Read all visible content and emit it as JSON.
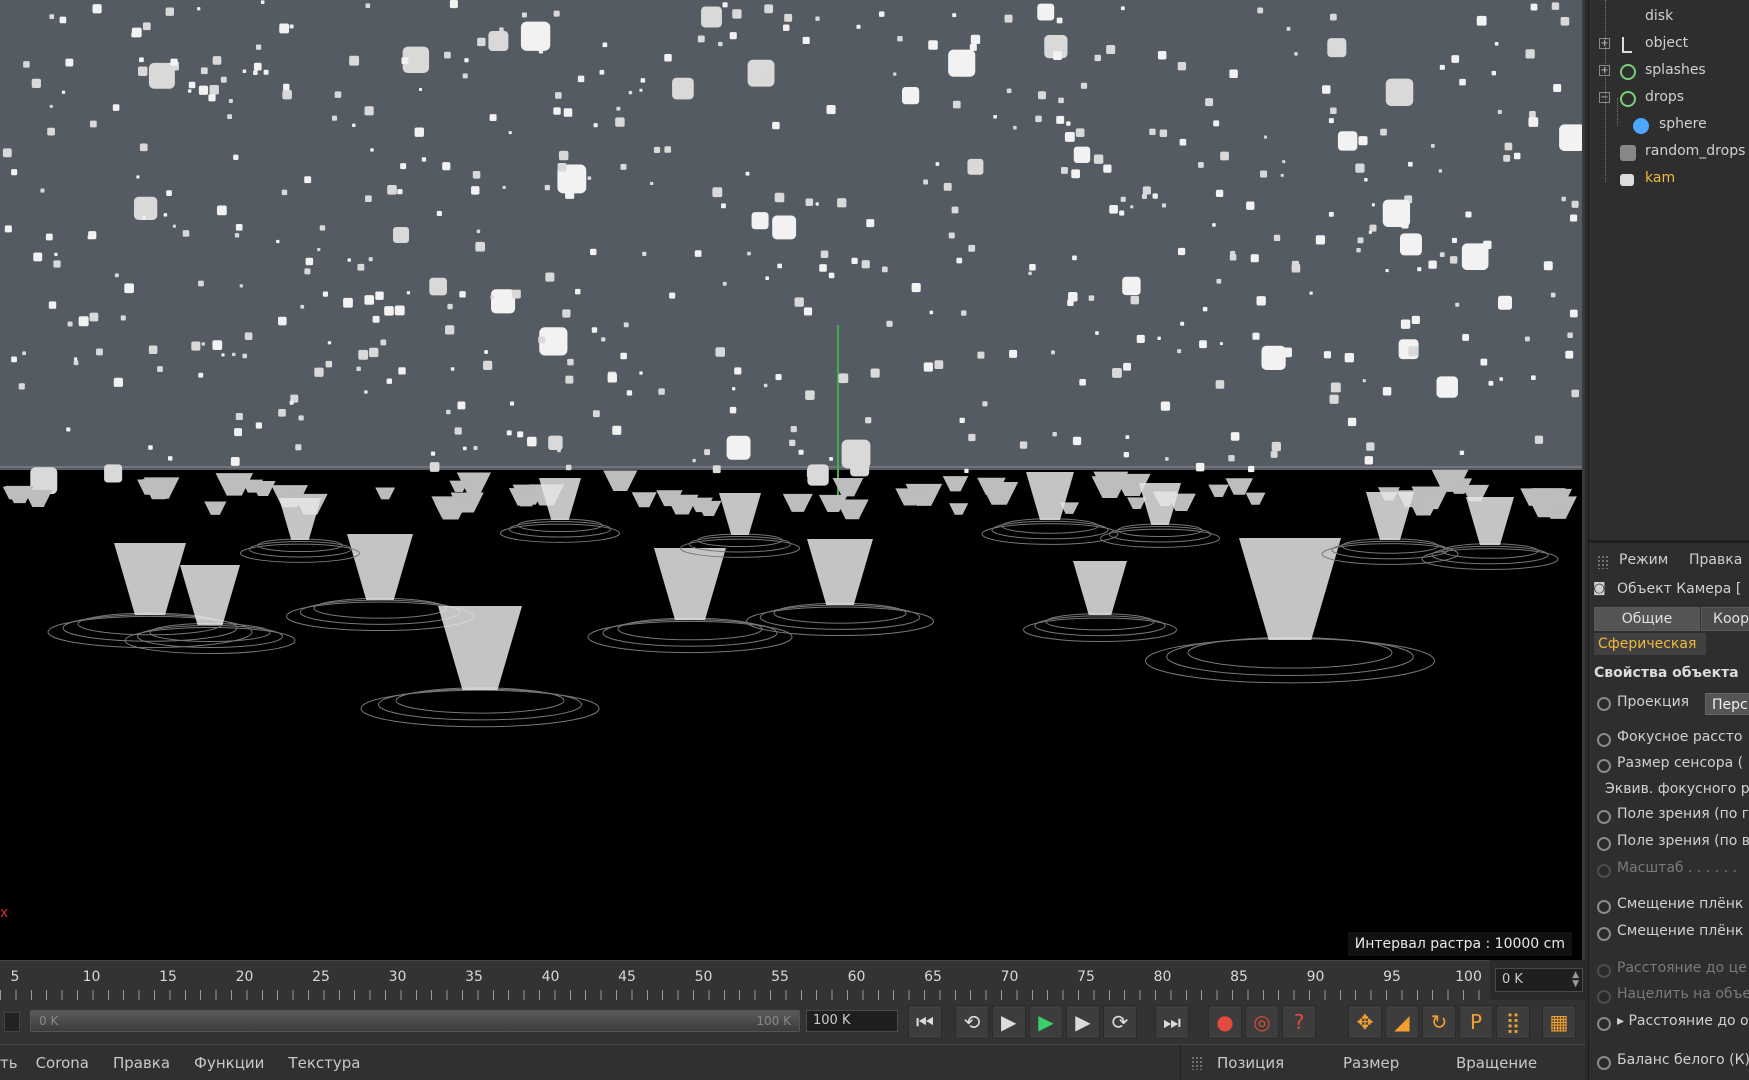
{
  "viewport": {
    "grid_label": "Интервал растра : 10000 cm",
    "x_axis_label": "x"
  },
  "timeline": {
    "ticks": [
      "5",
      "10",
      "15",
      "20",
      "25",
      "30",
      "35",
      "40",
      "45",
      "50",
      "55",
      "60",
      "65",
      "70",
      "75",
      "80",
      "85",
      "90",
      "95",
      "100"
    ],
    "current_frame": "0 K"
  },
  "transport": {
    "range_start": "0 K",
    "range_end": "100 K",
    "end_frame": "100 K",
    "buttons": {
      "go_start": "⏮",
      "prev_key": "⟲",
      "prev_frame": "◀",
      "play": "▶",
      "next_frame": "▶",
      "next_key": "⟳",
      "go_end": "⏭",
      "record": "●",
      "autokey": "◎",
      "keyframe_sel": "?",
      "move": "✥",
      "scale": "◢",
      "rotate": "↻",
      "param": "P",
      "points": "⣿",
      "film": "▦"
    }
  },
  "menubar": {
    "items": [
      "ть",
      "Corona",
      "Правка",
      "Функции",
      "Текстура"
    ]
  },
  "coords": {
    "position": "Позиция",
    "size": "Размер",
    "rotation": "Вращение"
  },
  "object_manager": {
    "items": [
      {
        "name": "disk",
        "icon": "disc-icon",
        "color": "#4aa8ff"
      },
      {
        "name": "object",
        "icon": "null-object-icon",
        "color": "#dddddd"
      },
      {
        "name": "splashes",
        "icon": "emitter-icon",
        "color": "#7ad07a"
      },
      {
        "name": "drops",
        "icon": "emitter-icon",
        "color": "#7ad07a"
      },
      {
        "name": "sphere",
        "icon": "sphere-icon",
        "color": "#4aa8ff"
      },
      {
        "name": "random_drops",
        "icon": "effector-icon",
        "color": "#bbbbbb"
      },
      {
        "name": "kam",
        "icon": "camera-icon",
        "color": "#dddddd"
      }
    ]
  },
  "attributes": {
    "mode_label": "Режим",
    "edit_label": "Правка",
    "object_title": "Объект Камера [",
    "tabs": [
      "Общие",
      "Коор"
    ],
    "spherical_tab": "Сферическая",
    "section_title": "Свойства объекта",
    "projection_label": "Проекция",
    "projection_value": "Перс",
    "fields": [
      "Фокусное рассто",
      "Размер сенсора (",
      "Эквив. фокусного р",
      "Поле зрения (по г",
      "Поле зрения (по в",
      "Масштаб . . . . . .",
      "Смещение плёнк",
      "Смещение плёнк",
      "Расстояние до це",
      "Нацелить на объе",
      "▸ Расстояние до о",
      "Баланс белого (К)"
    ]
  }
}
